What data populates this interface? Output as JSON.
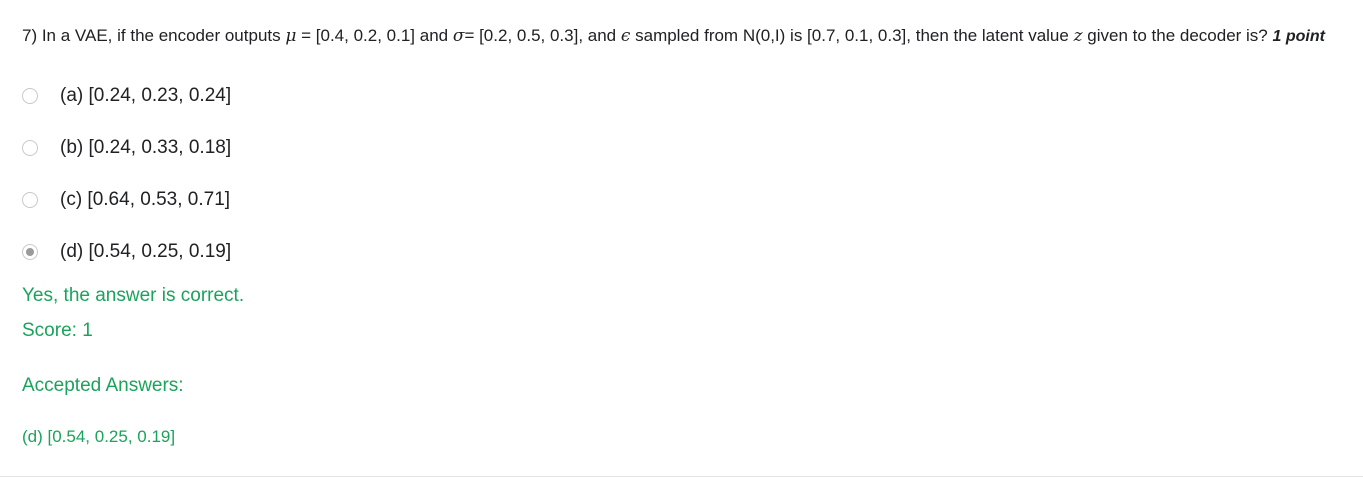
{
  "question": {
    "prefix": "7) In a VAE, if the encoder outputs ",
    "mu_symbol": "μ",
    "mu_part": " = [0.4, 0.2, 0.1] and ",
    "sigma_symbol": "σ",
    "sigma_part": "= [0.2, 0.5, 0.3], and ",
    "eps_symbol": "ϵ",
    "eps_part": " sampled from N(0,I) is [0.7, 0.1, 0.3], then the latent value ",
    "z_symbol": "z",
    "suffix": " given to the decoder is? ",
    "points": "1 point"
  },
  "options": [
    {
      "label": "(a) [0.24, 0.23, 0.24]",
      "selected": false
    },
    {
      "label": "(b) [0.24, 0.33, 0.18]",
      "selected": false
    },
    {
      "label": "(c) [0.64, 0.53, 0.71]",
      "selected": false
    },
    {
      "label": "(d) [0.54, 0.25, 0.19]",
      "selected": true
    }
  ],
  "feedback": {
    "message": "Yes, the answer is correct.",
    "score": "Score: 1",
    "accepted_title": "Accepted Answers:",
    "accepted_answer": "(d) [0.54, 0.25, 0.19]"
  },
  "colors": {
    "correct_green": "#1aa35a",
    "text": "#202124"
  }
}
